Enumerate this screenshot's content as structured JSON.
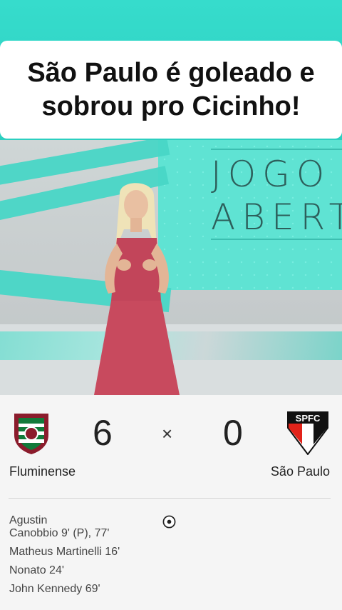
{
  "headline": {
    "line1": "São Paulo é goleado e",
    "line2": "sobrou pro Cicinho!"
  },
  "video": {
    "show_logo_line1": "JOGO",
    "show_logo_line2": "ABERTO"
  },
  "match": {
    "home_team": "Fluminense",
    "away_team": "São Paulo",
    "home_score": "6",
    "away_score": "0",
    "separator": "×",
    "away_badge_text": "SPFC",
    "home_scorers": [
      "Agustin\nCanobbio 9' (P), 77'",
      "Matheus Martinelli 16'",
      "Nonato 24'",
      "John Kennedy 69'"
    ]
  },
  "colors": {
    "accent_teal": "#2ad1c3",
    "fluminense_maroon": "#8b1c2c",
    "fluminense_green": "#127a3a",
    "spfc_red": "#e2231a"
  }
}
